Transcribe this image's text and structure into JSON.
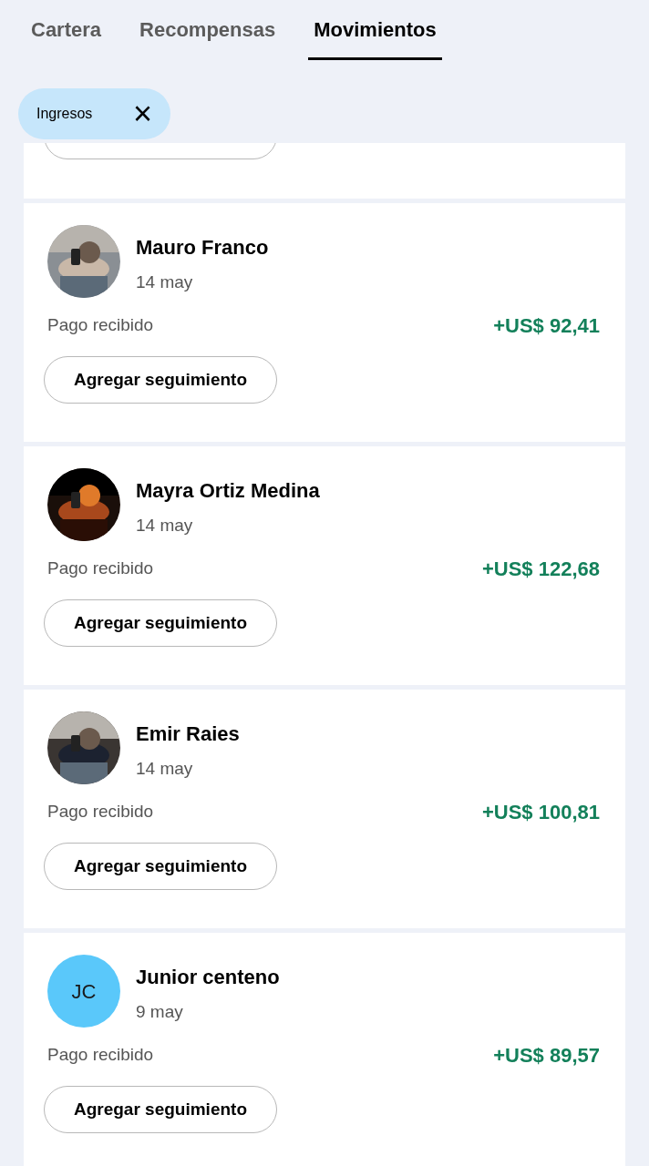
{
  "tabs": [
    {
      "label": "Cartera",
      "selected": false
    },
    {
      "label": "Recompensas",
      "selected": false
    },
    {
      "label": "Movimientos",
      "selected": true
    }
  ],
  "filter_chip": {
    "label": "Ingresos",
    "close_icon": "×"
  },
  "transactions": [
    {
      "name": "Mauro Franco",
      "date": "14 may",
      "type": "Pago recibido",
      "amount": "+US$ 92,41",
      "button": "Agregar seguimiento"
    },
    {
      "name": "Mayra Ortiz Medina",
      "date": "14 may",
      "type": "Pago recibido",
      "amount": "+US$ 122,68",
      "button": "Agregar seguimiento"
    },
    {
      "name": "Emir Raies",
      "date": "14 may",
      "type": "Pago recibido",
      "amount": "+US$ 100,81",
      "button": "Agregar seguimiento"
    },
    {
      "name": "Junior centeno",
      "date": "9 may",
      "type": "Pago recibido",
      "amount": "+US$ 89,57",
      "avatar": {
        "kind": "initials",
        "initials": "JC",
        "color": "#5ac8fa"
      },
      "button": "Agregar seguimiento"
    }
  ]
}
